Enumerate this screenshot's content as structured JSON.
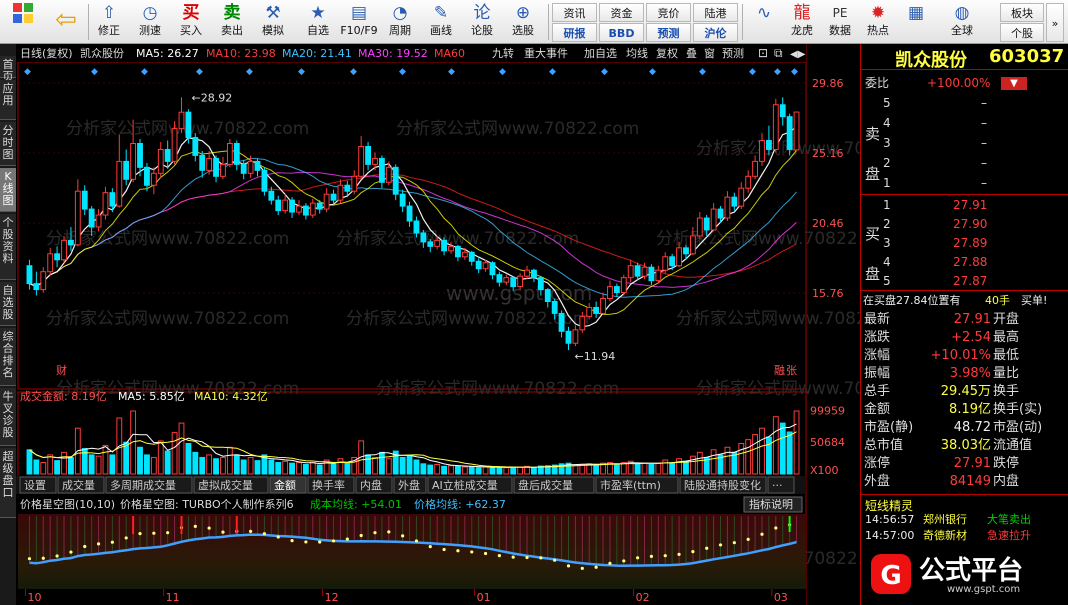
{
  "toolbar": {
    "row1": [
      {
        "label": "修正",
        "icon": "⇧",
        "name": "fix-button"
      },
      {
        "label": "测速",
        "icon": "◷",
        "name": "speed-test-button"
      },
      {
        "label": "买入",
        "icon": "买",
        "name": "buy-button"
      },
      {
        "label": "卖出",
        "icon": "卖",
        "name": "sell-button"
      },
      {
        "label": "模拟",
        "icon": "⚒",
        "name": "simulate-button"
      },
      {
        "label": "自选",
        "icon": "★",
        "name": "watchlist-button"
      },
      {
        "label": "F10/F9",
        "icon": "▤",
        "name": "f10-button"
      },
      {
        "label": "周期",
        "icon": "◔",
        "name": "period-button"
      },
      {
        "label": "画线",
        "icon": "✎",
        "name": "draw-line-button"
      },
      {
        "label": "论股",
        "icon": "论",
        "name": "forum-button"
      },
      {
        "label": "选股",
        "icon": "⊕",
        "name": "stock-select-button"
      }
    ],
    "grid": [
      {
        "label": "资讯",
        "name": "news-button"
      },
      {
        "label": "研报",
        "name": "research-button"
      },
      {
        "label": "资金",
        "name": "funds-button"
      },
      {
        "label": "BBD",
        "name": "bbd-button"
      },
      {
        "label": "竞价",
        "name": "auction-button"
      },
      {
        "label": "预测",
        "name": "forecast-button"
      },
      {
        "label": "陆港",
        "name": "hk-connect-button"
      },
      {
        "label": "沪伦",
        "name": "sh-london-button"
      }
    ],
    "row2": [
      {
        "label": "",
        "icon": "∿",
        "name": "chart-icon-button"
      },
      {
        "label": "龙虎",
        "icon": "龍",
        "name": "dragon-tiger-button"
      },
      {
        "label": "数据",
        "icon": "PE",
        "name": "data-button"
      },
      {
        "label": "热点",
        "icon": "✹",
        "name": "hotspot-button"
      },
      {
        "label": "",
        "icon": "▦",
        "name": "news-icon-button"
      },
      {
        "label": "全球",
        "icon": "◍",
        "name": "global-button"
      }
    ],
    "grid2": [
      {
        "label": "板块",
        "name": "sector-button"
      },
      {
        "label": "个股",
        "name": "single-stock-button"
      }
    ]
  },
  "lefttabs": [
    "首页",
    "应用",
    "分时图",
    "K线图",
    "个股资料",
    "自选股",
    "综合排名",
    "牛叉诊股",
    "超级盘口"
  ],
  "chart_header": {
    "title": "日线(复权)",
    "stock": "凯众股份",
    "ma5": "MA5: 26.27",
    "ma10": "MA10: 23.98",
    "ma20": "MA20: 21.41",
    "ma30": "MA30: 19.52",
    "ma60": "MA60",
    "buttons": [
      "九转",
      "重大事件",
      "加自选",
      "均线",
      "复权",
      "叠",
      "窗",
      "预测"
    ]
  },
  "price_axis": [
    "29.86",
    "25.16",
    "20.46",
    "15.76"
  ],
  "annotations": {
    "high": "28.92",
    "low": "11.94",
    "cai": "财",
    "rong": "融",
    "zhang": "张"
  },
  "volume_header": {
    "label": "成交金额: 8.19亿",
    "ma5": "MA5: 5.85亿",
    "ma10": "MA10: 4.32亿"
  },
  "volume_axis": [
    "99959",
    "50684",
    "X100"
  ],
  "tabs": [
    "设置",
    "成交量",
    "多周期成交量",
    "虚拟成交量",
    "金额",
    "换手率",
    "内盘",
    "外盘",
    "AI立桩成交量",
    "盘后成交量",
    "市盈率(ttm)",
    "陆股通持股变化",
    "···"
  ],
  "indicator_header": {
    "title": "价格星空图(10,10)",
    "sub": "价格星空图: TURBO个人制作系列6",
    "cost": "成本均线: +54.01",
    "price": "价格均线: +62.37",
    "button": "指标说明"
  },
  "x_axis": [
    "10",
    "11",
    "12",
    "01",
    "02",
    "03"
  ],
  "watermarks": [
    "分析家公式网www.70822.com",
    "www.gspt.com"
  ],
  "right": {
    "title": "凯众股份",
    "code": "603037",
    "weibi_label": "委比",
    "weibi_value": "+100.00%",
    "sell_label": "卖盘",
    "buy_label": "买盘",
    "sells": [
      {
        "n": "5",
        "p": "–"
      },
      {
        "n": "4",
        "p": "–"
      },
      {
        "n": "3",
        "p": "–"
      },
      {
        "n": "2",
        "p": "–"
      },
      {
        "n": "1",
        "p": "–"
      }
    ],
    "buys": [
      {
        "n": "1",
        "p": "27.91"
      },
      {
        "n": "2",
        "p": "27.90"
      },
      {
        "n": "3",
        "p": "27.89"
      },
      {
        "n": "4",
        "p": "27.88"
      },
      {
        "n": "5",
        "p": "27.87"
      }
    ],
    "inbuy": "在买盘27.84位置有",
    "inbuy_qty": "40手",
    "inbuy_tag": "买单!",
    "stats": [
      {
        "l": "最新",
        "v": "27.91",
        "r": "开盘",
        "c": "red"
      },
      {
        "l": "涨跌",
        "v": "+2.54",
        "r": "最高",
        "c": "red"
      },
      {
        "l": "涨幅",
        "v": "+10.01%",
        "r": "最低",
        "c": "red"
      },
      {
        "l": "振幅",
        "v": "3.98%",
        "r": "量比",
        "c": "red"
      },
      {
        "l": "总手",
        "v": "29.45万",
        "r": "换手",
        "c": "yel"
      },
      {
        "l": "金额",
        "v": "8.19亿",
        "r": "换手(实)",
        "c": "yel"
      },
      {
        "l": "市盈(静)",
        "v": "48.72",
        "r": "市盈(动)",
        "c": "wht"
      },
      {
        "l": "总市值",
        "v": "38.03亿",
        "r": "流通值",
        "c": "yel"
      },
      {
        "l": "涨停",
        "v": "27.91",
        "r": "跌停",
        "c": "red"
      },
      {
        "l": "外盘",
        "v": "84149",
        "r": "内盘",
        "c": "red"
      }
    ],
    "elf_title": "短线精灵",
    "elf": [
      {
        "t": "14:56:57",
        "s": "郑州银行",
        "e": "大笔卖出"
      },
      {
        "t": "14:57:00",
        "s": "奇德新材",
        "e": "急速拉升"
      }
    ],
    "logo_text": "公式平台",
    "logo_url": "www.gspt.com"
  },
  "colors": {
    "up": "#ff3b3b",
    "down": "#00e5ff",
    "ma5": "#ffffff",
    "ma10": "#ffff00",
    "ma20": "#40c0ff",
    "ma30": "#ff40ff",
    "ma60": "#ff2020"
  },
  "chart_data": {
    "type": "candlestick",
    "ylim": [
      10,
      31
    ],
    "candles": [
      [
        17.6,
        16.4,
        18.0,
        16.0
      ],
      [
        16.4,
        16.0,
        17.2,
        15.6
      ],
      [
        16.0,
        17.2,
        17.5,
        15.8
      ],
      [
        17.2,
        18.4,
        18.8,
        16.9
      ],
      [
        18.4,
        18.0,
        18.9,
        17.5
      ],
      [
        18.0,
        19.3,
        19.6,
        17.8
      ],
      [
        19.3,
        19.0,
        20.2,
        18.6
      ],
      [
        19.0,
        22.6,
        23.4,
        18.9
      ],
      [
        22.6,
        21.4,
        23.0,
        21.0
      ],
      [
        21.4,
        20.2,
        21.6,
        19.6
      ],
      [
        20.2,
        21.0,
        21.4,
        19.9
      ],
      [
        21.0,
        22.5,
        22.9,
        20.7
      ],
      [
        22.5,
        21.6,
        22.8,
        21.2
      ],
      [
        21.6,
        24.6,
        26.4,
        21.5
      ],
      [
        24.6,
        23.4,
        25.4,
        23.0
      ],
      [
        23.4,
        25.8,
        27.4,
        23.2
      ],
      [
        25.8,
        24.2,
        26.1,
        23.6
      ],
      [
        24.2,
        23.0,
        24.5,
        22.6
      ],
      [
        23.0,
        23.8,
        24.2,
        22.4
      ],
      [
        23.8,
        25.4,
        25.9,
        23.5
      ],
      [
        25.4,
        24.6,
        26.0,
        24.1
      ],
      [
        24.6,
        26.8,
        27.3,
        24.4
      ],
      [
        26.8,
        27.9,
        28.9,
        26.5
      ],
      [
        27.9,
        26.2,
        28.1,
        25.8
      ],
      [
        26.2,
        25.0,
        26.5,
        24.6
      ],
      [
        25.0,
        24.0,
        25.3,
        23.5
      ],
      [
        24.0,
        24.8,
        25.3,
        23.7
      ],
      [
        24.8,
        23.6,
        25.0,
        23.2
      ],
      [
        23.6,
        24.4,
        24.9,
        23.4
      ],
      [
        24.4,
        25.8,
        26.1,
        24.2
      ],
      [
        25.8,
        24.4,
        26.0,
        24.0
      ],
      [
        24.4,
        23.8,
        24.7,
        23.4
      ],
      [
        23.8,
        24.6,
        25.0,
        23.5
      ],
      [
        24.6,
        24.0,
        24.8,
        23.6
      ],
      [
        24.0,
        22.6,
        24.2,
        22.3
      ],
      [
        22.6,
        22.0,
        22.9,
        21.7
      ],
      [
        22.0,
        21.3,
        22.3,
        21.0
      ],
      [
        21.3,
        22.0,
        22.4,
        21.1
      ],
      [
        22.0,
        21.2,
        22.2,
        20.8
      ],
      [
        21.2,
        21.6,
        22.0,
        21.0
      ],
      [
        21.6,
        21.0,
        21.8,
        20.7
      ],
      [
        21.0,
        21.8,
        22.1,
        20.8
      ],
      [
        21.8,
        21.4,
        22.0,
        21.1
      ],
      [
        21.4,
        22.4,
        22.8,
        21.2
      ],
      [
        22.4,
        22.0,
        22.7,
        21.7
      ],
      [
        22.0,
        23.0,
        23.4,
        21.8
      ],
      [
        23.0,
        22.6,
        23.3,
        22.2
      ],
      [
        22.6,
        23.6,
        24.0,
        22.4
      ],
      [
        23.6,
        25.6,
        26.3,
        23.4
      ],
      [
        25.6,
        24.4,
        25.9,
        24.0
      ],
      [
        24.4,
        24.8,
        25.2,
        24.0
      ],
      [
        24.8,
        23.2,
        25.0,
        22.8
      ],
      [
        23.2,
        24.2,
        24.6,
        23.0
      ],
      [
        24.2,
        22.4,
        24.4,
        22.0
      ],
      [
        22.4,
        21.6,
        22.7,
        21.2
      ],
      [
        21.6,
        20.6,
        21.9,
        20.2
      ],
      [
        20.6,
        19.8,
        20.9,
        19.5
      ],
      [
        19.8,
        19.2,
        20.0,
        18.8
      ],
      [
        19.2,
        18.9,
        19.4,
        18.5
      ],
      [
        18.9,
        19.3,
        19.6,
        18.7
      ],
      [
        19.3,
        18.6,
        19.5,
        18.3
      ],
      [
        18.6,
        18.9,
        19.2,
        18.4
      ],
      [
        18.9,
        18.2,
        19.0,
        17.9
      ],
      [
        18.2,
        18.5,
        18.8,
        18.0
      ],
      [
        18.5,
        17.9,
        18.6,
        17.6
      ],
      [
        17.9,
        17.4,
        18.1,
        17.1
      ],
      [
        17.4,
        17.8,
        18.0,
        17.2
      ],
      [
        17.8,
        17.0,
        17.9,
        16.7
      ],
      [
        17.0,
        16.5,
        17.2,
        16.2
      ],
      [
        16.5,
        16.8,
        17.0,
        16.3
      ],
      [
        16.8,
        16.2,
        16.9,
        15.9
      ],
      [
        16.2,
        16.9,
        17.1,
        16.0
      ],
      [
        16.9,
        17.3,
        17.6,
        16.7
      ],
      [
        17.3,
        16.8,
        17.4,
        16.5
      ],
      [
        16.8,
        16.0,
        16.9,
        15.6
      ],
      [
        16.0,
        15.2,
        16.1,
        14.8
      ],
      [
        15.2,
        14.4,
        15.4,
        14.0
      ],
      [
        14.4,
        13.2,
        14.6,
        12.8
      ],
      [
        13.2,
        12.4,
        13.5,
        11.94
      ],
      [
        12.4,
        13.3,
        13.6,
        12.2
      ],
      [
        13.3,
        14.2,
        14.5,
        13.1
      ],
      [
        14.2,
        14.8,
        15.1,
        14.0
      ],
      [
        14.8,
        14.4,
        15.2,
        14.1
      ],
      [
        14.4,
        15.4,
        15.8,
        14.3
      ],
      [
        15.4,
        16.2,
        16.6,
        15.2
      ],
      [
        16.2,
        15.8,
        16.4,
        15.5
      ],
      [
        15.8,
        16.8,
        17.0,
        15.6
      ],
      [
        16.8,
        17.6,
        18.0,
        16.5
      ],
      [
        17.6,
        16.9,
        17.8,
        16.6
      ],
      [
        16.9,
        17.5,
        17.8,
        16.7
      ],
      [
        17.5,
        16.6,
        17.7,
        16.3
      ],
      [
        16.6,
        17.3,
        17.6,
        16.4
      ],
      [
        17.3,
        18.2,
        18.5,
        17.1
      ],
      [
        18.2,
        17.6,
        18.4,
        17.3
      ],
      [
        17.6,
        18.8,
        19.2,
        17.5
      ],
      [
        18.8,
        18.4,
        19.0,
        18.0
      ],
      [
        18.4,
        19.6,
        20.2,
        18.3
      ],
      [
        19.6,
        20.8,
        21.2,
        19.4
      ],
      [
        20.8,
        20.0,
        21.0,
        19.6
      ],
      [
        20.0,
        21.4,
        21.8,
        19.9
      ],
      [
        21.4,
        20.8,
        21.6,
        20.5
      ],
      [
        20.8,
        22.2,
        22.6,
        20.6
      ],
      [
        22.2,
        21.6,
        22.5,
        21.3
      ],
      [
        21.6,
        22.8,
        23.2,
        21.4
      ],
      [
        22.8,
        23.6,
        24.0,
        22.5
      ],
      [
        23.6,
        24.6,
        25.0,
        23.4
      ],
      [
        24.6,
        26.0,
        26.5,
        24.3
      ],
      [
        26.0,
        25.4,
        27.0,
        25.0
      ],
      [
        25.4,
        28.4,
        28.8,
        25.2
      ],
      [
        28.4,
        27.6,
        28.9,
        27.0
      ],
      [
        27.6,
        25.4,
        27.8,
        25.0
      ],
      [
        25.37,
        27.91,
        27.91,
        26.8
      ]
    ],
    "ma": {
      "ma5": "MA5",
      "ma10": "MA10",
      "ma20": "MA20",
      "ma30": "MA30",
      "ma60": "MA60"
    },
    "volume_ylim": [
      0,
      110000
    ],
    "volume": [
      38000,
      22000,
      18000,
      30000,
      21000,
      34000,
      26000,
      72000,
      40000,
      30000,
      28000,
      45000,
      30000,
      88000,
      50000,
      99000,
      42000,
      30000,
      26000,
      52000,
      36000,
      65000,
      80000,
      48000,
      34000,
      26000,
      30000,
      24000,
      26000,
      42000,
      30000,
      22000,
      26000,
      21000,
      30000,
      22000,
      18000,
      20000,
      17000,
      18000,
      15000,
      18000,
      14000,
      22000,
      16000,
      24000,
      17000,
      26000,
      52000,
      30000,
      26000,
      34000,
      24000,
      36000,
      26000,
      28000,
      22000,
      16000,
      14000,
      15000,
      12000,
      13000,
      12000,
      11000,
      12000,
      10000,
      11000,
      10000,
      11000,
      10000,
      10500,
      11000,
      12000,
      10000,
      12500,
      13000,
      14000,
      16000,
      17000,
      14000,
      15000,
      16000,
      14000,
      17000,
      18000,
      15000,
      18000,
      20000,
      16000,
      17000,
      15000,
      17000,
      22000,
      18000,
      24000,
      20000,
      28000,
      34000,
      26000,
      38000,
      30000,
      42000,
      34000,
      48000,
      54000,
      62000,
      72000,
      58000,
      90000,
      80000,
      66000,
      99000
    ]
  }
}
